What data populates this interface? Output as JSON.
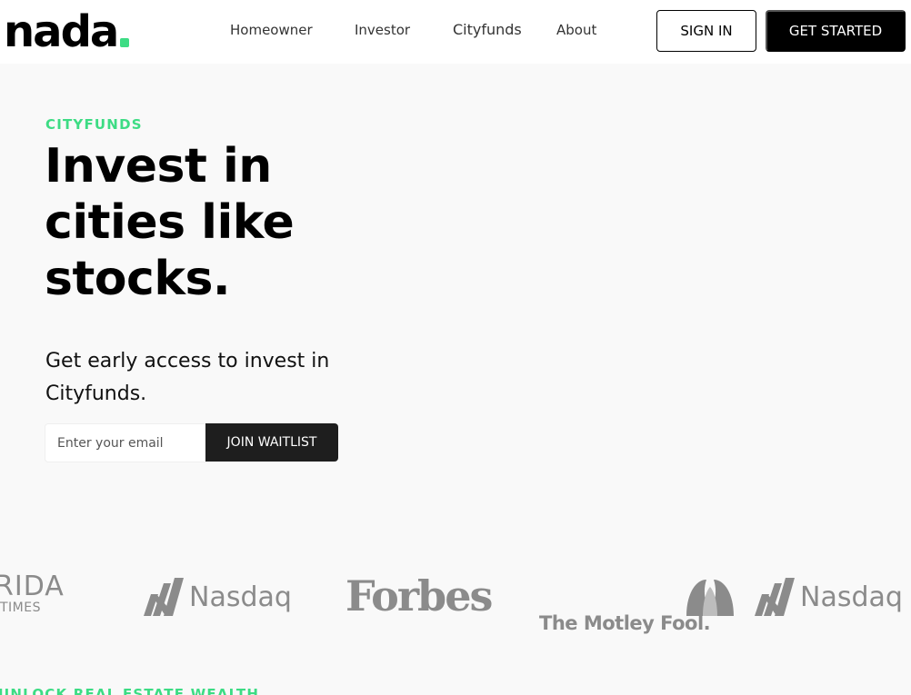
{
  "brand": {
    "name": "nada",
    "accent_color": "#3ddc84"
  },
  "nav": {
    "links": [
      {
        "label": "Homeowner"
      },
      {
        "label": "Investor"
      },
      {
        "label": "Cityfunds"
      },
      {
        "label": "About"
      }
    ],
    "sign_in_label": "SIGN IN",
    "get_started_label": "GET STARTED"
  },
  "hero": {
    "eyebrow": "CITYFUNDS",
    "title": "Invest in cities like stocks.",
    "subtitle": "Get early access to invest in Cityfunds.",
    "email_placeholder": "Enter your email",
    "cta_label": "JOIN WAITLIST"
  },
  "press": {
    "logos": [
      {
        "name": "florida-times-logo",
        "main": "RIDA",
        "sub": "TIMES"
      },
      {
        "name": "nasdaq-logo",
        "text": "Nasdaq"
      },
      {
        "name": "forbes-logo",
        "text": "Forbes"
      },
      {
        "name": "motley-fool-logo",
        "text": "The Motley Fool."
      },
      {
        "name": "nasdaq-logo",
        "text": "Nasdaq"
      }
    ]
  },
  "section2": {
    "eyebrow": "UNLOCK REAL ESTATE WEALTH"
  }
}
